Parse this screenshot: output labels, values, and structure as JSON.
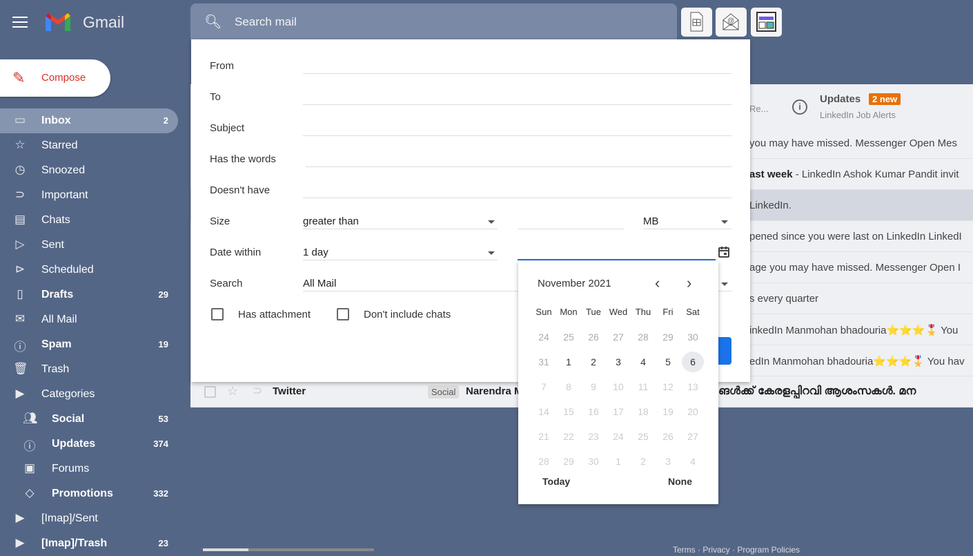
{
  "app": {
    "name": "Gmail",
    "compose": "Compose"
  },
  "search": {
    "placeholder": "Search mail"
  },
  "sidebar": [
    {
      "label": "Inbox",
      "count": "2",
      "icon": "inbox-icon",
      "bold": true,
      "active": true
    },
    {
      "label": "Starred",
      "count": "",
      "icon": "star-icon"
    },
    {
      "label": "Snoozed",
      "count": "",
      "icon": "clock-icon"
    },
    {
      "label": "Important",
      "count": "",
      "icon": "important-icon"
    },
    {
      "label": "Chats",
      "count": "",
      "icon": "chat-icon"
    },
    {
      "label": "Sent",
      "count": "",
      "icon": "send-icon"
    },
    {
      "label": "Scheduled",
      "count": "",
      "icon": "scheduled-icon"
    },
    {
      "label": "Drafts",
      "count": "29",
      "icon": "draft-icon",
      "bold": true
    },
    {
      "label": "All Mail",
      "count": "",
      "icon": "mail-icon"
    },
    {
      "label": "Spam",
      "count": "19",
      "icon": "spam-icon",
      "bold": true
    },
    {
      "label": "Trash",
      "count": "",
      "icon": "trash-icon"
    },
    {
      "label": "Categories",
      "count": "",
      "icon": "label-icon"
    },
    {
      "label": "Social",
      "count": "53",
      "icon": "people-icon",
      "bold": true,
      "sub": true
    },
    {
      "label": "Updates",
      "count": "374",
      "icon": "info-icon",
      "bold": true,
      "sub": true
    },
    {
      "label": "Forums",
      "count": "",
      "icon": "forum-icon",
      "sub": true
    },
    {
      "label": "Promotions",
      "count": "332",
      "icon": "tag-icon",
      "bold": true,
      "sub": true
    },
    {
      "label": "[Imap]/Sent",
      "count": "",
      "icon": "label-icon"
    },
    {
      "label": "[Imap]/Trash",
      "count": "23",
      "icon": "label-icon",
      "bold": true
    }
  ],
  "tabs": {
    "partial": "Re...",
    "updates": "Updates",
    "updates_badge": "2 new",
    "updates_sub": "LinkedIn Job Alerts"
  },
  "rows": [
    {
      "bold": "",
      "text": "you may have missed. Messenger Open Mes"
    },
    {
      "bold": "ast week",
      "text": " - LinkedIn Ashok Kumar Pandit invit"
    },
    {
      "bold": "",
      "text": "LinkedIn."
    },
    {
      "bold": "",
      "text": "pened since you were last on LinkedIn LinkedI"
    },
    {
      "bold": "",
      "text": "age you may have missed. Messenger Open I"
    },
    {
      "bold": "",
      "text": "s every quarter"
    },
    {
      "bold": "",
      "text": "inkedIn Manmohan bhadouria⭐⭐⭐🎖️ You"
    },
    {
      "bold": "",
      "text": "edIn Manmohan bhadouria⭐⭐⭐🎖️ You hav"
    }
  ],
  "twitter_row": {
    "sender": "Twitter",
    "tag": "Social",
    "subject": "Narendra M",
    "snippet": "ങൾക്ക് കേരളപ്പിറവി ആശംസകൾ. മന"
  },
  "filter": {
    "from": "From",
    "to": "To",
    "subject": "Subject",
    "has_words": "Has the words",
    "doesnt_have": "Doesn't have",
    "size": "Size",
    "size_op": "greater than",
    "size_unit": "MB",
    "date_within": "Date within",
    "date_value": "1 day",
    "search": "Search",
    "search_value": "All Mail",
    "has_attachment": "Has attachment",
    "no_chats": "Don't include chats"
  },
  "calendar": {
    "month": "November 2021",
    "weekdays": [
      "Sun",
      "Mon",
      "Tue",
      "Wed",
      "Thu",
      "Fri",
      "Sat"
    ],
    "weeks": [
      [
        "24",
        "25",
        "26",
        "27",
        "28",
        "29",
        "30"
      ],
      [
        "31",
        "1",
        "2",
        "3",
        "4",
        "5",
        "6"
      ],
      [
        "7",
        "8",
        "9",
        "10",
        "11",
        "12",
        "13"
      ],
      [
        "14",
        "15",
        "16",
        "17",
        "18",
        "19",
        "20"
      ],
      [
        "21",
        "22",
        "23",
        "24",
        "25",
        "26",
        "27"
      ],
      [
        "28",
        "29",
        "30",
        "1",
        "2",
        "3",
        "4"
      ]
    ],
    "selected": "6",
    "today": "Today",
    "none": "None"
  },
  "footer": "Terms · Privacy · Program Policies"
}
